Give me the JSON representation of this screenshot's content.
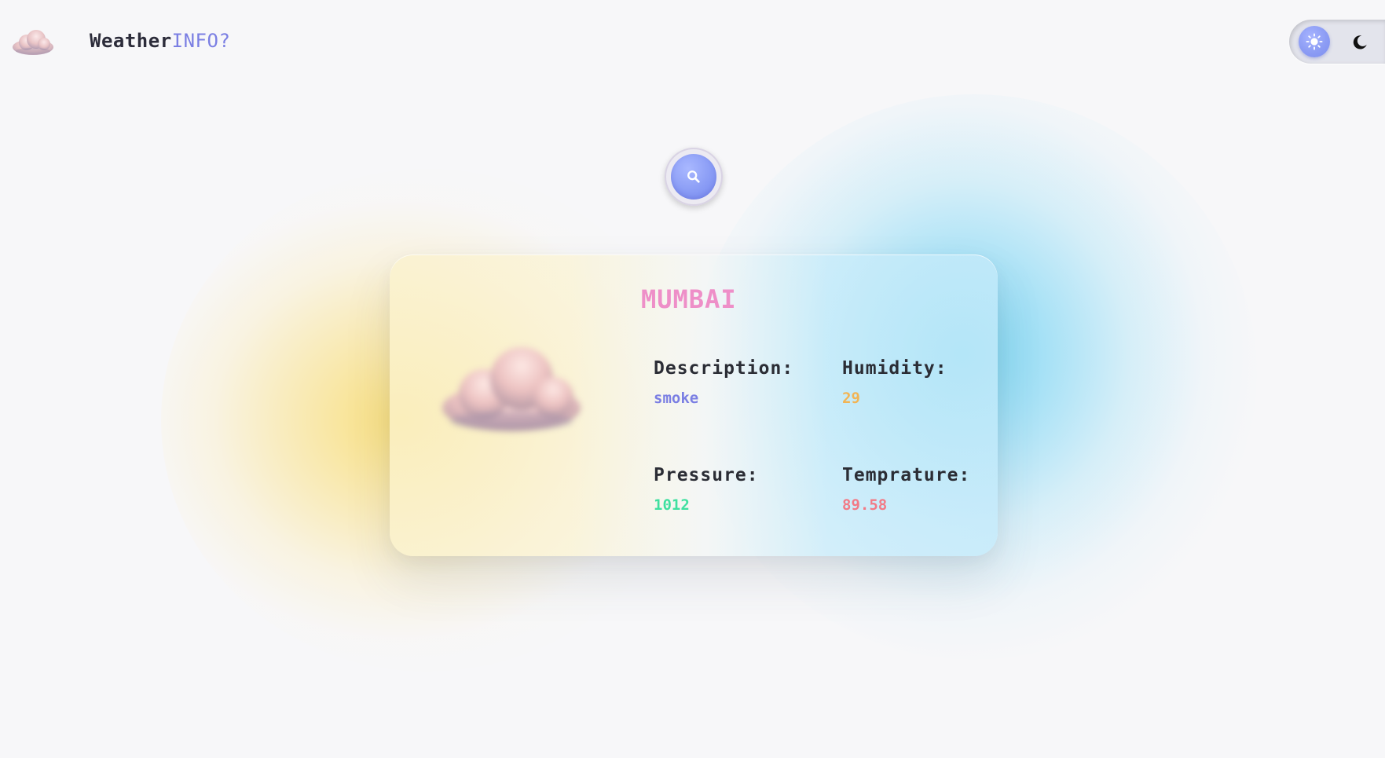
{
  "header": {
    "brand_main": "Weather",
    "brand_accent": "INFO?",
    "logo_icon": "cloud-icon"
  },
  "theme_toggle": {
    "active": "light",
    "light_icon": "sun-icon",
    "dark_icon": "moon-icon"
  },
  "search": {
    "icon": "search-icon"
  },
  "weather": {
    "city": "MUMBAI",
    "image_icon": "cloud-icon",
    "stats": {
      "description": {
        "label": "Description:",
        "value": "smoke",
        "color": "#7b7fe3"
      },
      "humidity": {
        "label": "Humidity:",
        "value": "29",
        "color": "#f2b454"
      },
      "pressure": {
        "label": "Pressure:",
        "value": "1012",
        "color": "#3fe0a0"
      },
      "temperature": {
        "label": "Temprature:",
        "value": "89.58",
        "color": "#f27a86"
      }
    }
  },
  "colors": {
    "background": "#f7f7f9",
    "accent": "#7b7fe3",
    "city": "#ee8fc8"
  }
}
